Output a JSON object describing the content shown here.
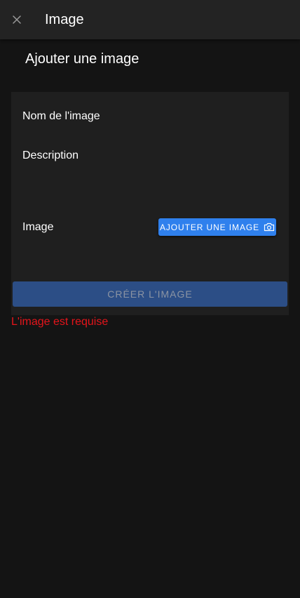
{
  "app_bar": {
    "title": "Image",
    "close_icon": "close-icon"
  },
  "page": {
    "heading": "Ajouter une image"
  },
  "form": {
    "name_label": "Nom de l'image",
    "description_label": "Description",
    "image_label": "Image",
    "add_image_button": "AJOUTER UNE IMAGE",
    "add_image_icon": "camera-icon",
    "submit_button": "CRÉER L'IMAGE",
    "error_message": "L'image est requise"
  },
  "colors": {
    "background": "#141414",
    "app_bar": "#232323",
    "card": "#1f1f1f",
    "accent": "#2f80ed",
    "submit_disabled": "#2c4e86",
    "error": "#e5141b"
  }
}
